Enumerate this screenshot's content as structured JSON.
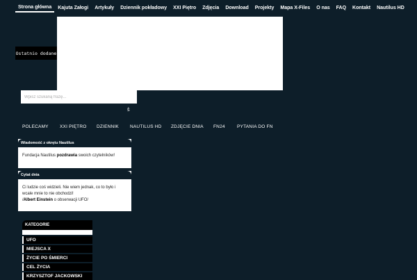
{
  "nav": {
    "items": [
      {
        "label": "Strona główna",
        "active": true
      },
      {
        "label": "Kajuta Załogi"
      },
      {
        "label": "Artykuły"
      },
      {
        "label": "Dziennik pokładowy"
      },
      {
        "label": "XXI Piętro"
      },
      {
        "label": "Zdjęcia"
      },
      {
        "label": "Download"
      },
      {
        "label": "Projekty"
      },
      {
        "label": "Mapa X-Files"
      },
      {
        "label": "O nas"
      },
      {
        "label": "FAQ"
      },
      {
        "label": "Kontakt"
      },
      {
        "label": "Nautilus HD"
      }
    ]
  },
  "recent": {
    "label": "Ostatnio dodane"
  },
  "search": {
    "placeholder": "Wpisz szukaną frazę...",
    "icon": "search-icon"
  },
  "catnav": {
    "items": [
      "POLECAMY",
      "XXI PIĘTRO",
      "DZIENNIK",
      "NAUTILUS HD",
      "ZDJĘCIE DNIA",
      "FN24",
      "PYTANIA DO FN"
    ]
  },
  "message": {
    "title": "Wiadomość z okrętu Nautilus",
    "text_before": "Fundacja Nautilus ",
    "bold": "pozdrawia",
    "text_after": " swoich czytelników!"
  },
  "quote": {
    "title": "Cytat dnia",
    "text": "Ci ludzie coś widzieli. Nie wiem jednak, co to było i wcale mnie to nie obchodzi!",
    "prefix": "/",
    "author": "Albert Einstein",
    "suffix": " o obserwacji UFO/"
  },
  "categories": {
    "title": "KATEGORIE",
    "items": [
      "UFO",
      "MIEJSCA X",
      "ŻYCIE PO ŚMIERCI",
      "CEL ŻYCIA",
      "KRZYSZTOF JACKOWSKI"
    ]
  },
  "colors": {
    "background": "#0d1e29",
    "panel": "#ffffff",
    "dark": "#000000"
  }
}
